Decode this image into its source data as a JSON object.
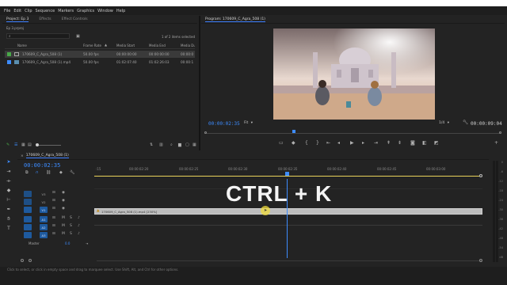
{
  "menu": [
    "File",
    "Edit",
    "Clip",
    "Sequence",
    "Markers",
    "Graphics",
    "Window",
    "Help"
  ],
  "project_panel": {
    "tabs": [
      "Project: Ep 3",
      "Effects",
      "Effect Controls"
    ],
    "project_file": "Ep 3.prproj",
    "selection_count": "1 of 2 items selected",
    "columns": [
      "Name",
      "Frame Rate",
      "Media Start",
      "Media End",
      "Media Du"
    ],
    "rows": [
      {
        "name": "170609_C_Agra_508 (1)",
        "frame_rate": "50.00 fps",
        "media_start": "00:00:00:00",
        "media_end": "00:00:00:00",
        "media_dur": "00:00:0",
        "color": "#49a849",
        "type": "sequence"
      },
      {
        "name": "170609_C_Agra_508 (1).mp4",
        "frame_rate": "50.00 fps",
        "media_start": "01:02:07:40",
        "media_end": "01:02:26:03",
        "media_dur": "00:00:1",
        "color": "#3d8cff",
        "type": "clip"
      }
    ]
  },
  "program_monitor": {
    "title": "Program: 170609_C_Agra_508 (1)",
    "timecode": "00:00:02:35",
    "fit": "Fit",
    "resolution": "1/4",
    "duration": "00:00:09:04"
  },
  "timeline": {
    "tab": "170609_C_Agra_508 (1)",
    "timecode": "00:00:02:35",
    "ruler_labels": [
      ":15",
      "00:00:02:20",
      "00:00:02:25",
      "00:00:02:30",
      "00:00:02:35",
      "00:00:02:40",
      "00:00:02:45",
      "00:00:03:00"
    ],
    "overlay_text": "CTRL + K",
    "clip_label": "170609_C_Agra_508 (1).mp4 [230%]",
    "video_tracks": [
      "V3",
      "V2",
      "V1"
    ],
    "audio_tracks": [
      "A1",
      "A2",
      "A3"
    ],
    "master_label": "Master",
    "master_value": "0.0",
    "track_icons": {
      "sync": "S",
      "mute": "M"
    }
  },
  "meter_labels": [
    "0",
    "-6",
    "-12",
    "-18",
    "-24",
    "-30",
    "-36",
    "-42",
    "-48",
    "-54",
    "dB"
  ],
  "status_bar": "Click to select, or click in empty space and drag to marquee select. Use Shift, Alt, and Ctrl for other options.",
  "colors": {
    "accent": "#3d8cff",
    "playhead": "#3d8cff",
    "clip": "#b8b8b8",
    "work_area": "#e8d25a"
  }
}
